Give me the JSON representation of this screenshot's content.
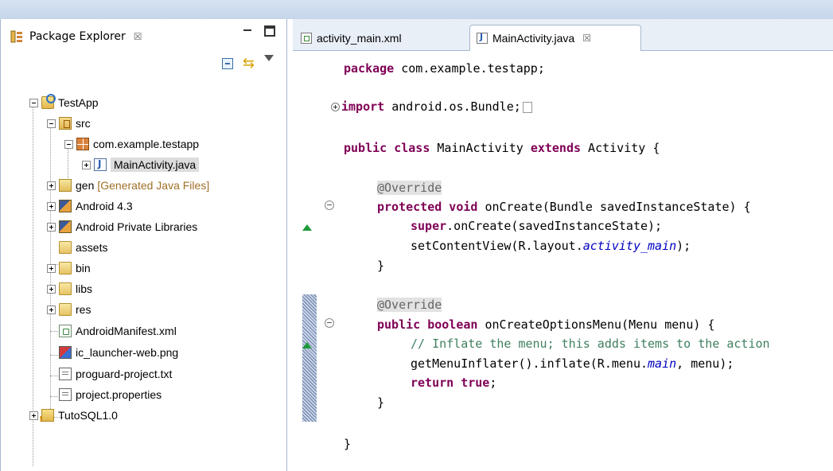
{
  "package_explorer": {
    "title": "Package Explorer",
    "close_glyph": "☒",
    "tree": [
      {
        "label": "TestApp",
        "icon": "android-project-icon"
      },
      {
        "label": "src",
        "icon": "source-folder-icon"
      },
      {
        "label": "com.example.testapp",
        "icon": "package-icon"
      },
      {
        "label": "MainActivity.java",
        "icon": "java-file-icon",
        "selected": true
      },
      {
        "label": "gen",
        "decoration": "[Generated Java Files]",
        "icon": "generated-folder-icon"
      },
      {
        "label": "Android 4.3",
        "icon": "library-icon"
      },
      {
        "label": "Android Private Libraries",
        "icon": "library-icon"
      },
      {
        "label": "assets",
        "icon": "folder-icon"
      },
      {
        "label": "bin",
        "icon": "folder-icon"
      },
      {
        "label": "libs",
        "icon": "folder-icon"
      },
      {
        "label": "res",
        "icon": "folder-icon"
      },
      {
        "label": "AndroidManifest.xml",
        "icon": "xml-file-icon"
      },
      {
        "label": "ic_launcher-web.png",
        "icon": "image-file-icon"
      },
      {
        "label": "proguard-project.txt",
        "icon": "text-file-icon"
      },
      {
        "label": "project.properties",
        "icon": "text-file-icon"
      },
      {
        "label": "TutoSQL1.0",
        "icon": "android-project-icon"
      }
    ]
  },
  "editor": {
    "tabs": [
      {
        "label": "activity_main.xml",
        "active": false
      },
      {
        "label": "MainActivity.java",
        "active": true,
        "close_glyph": "☒"
      }
    ],
    "code": {
      "l1_kw": "package",
      "l1_rest": " com.example.testapp;",
      "l2_kw": "import",
      "l2_rest": " android.os.Bundle;",
      "l3_kw": "public class",
      "l3_mid": " MainActivity ",
      "l3_kw2": "extends",
      "l3_rest": " Activity {",
      "l4_ann": "@Override",
      "l5_kw": "protected void",
      "l5_rest": " onCreate(Bundle savedInstanceState) {",
      "l6_kw": "super",
      "l6_rest": ".onCreate(savedInstanceState);",
      "l7_pre": "setContentView(R.layout.",
      "l7_fld": "activity_main",
      "l7_post": ");",
      "l8": "}",
      "l9_ann": "@Override",
      "l10_kw": "public boolean",
      "l10_rest": " onCreateOptionsMenu(Menu menu) {",
      "l11_cmt": "// Inflate the menu; this adds items to the action",
      "l12_pre": "getMenuInflater().inflate(R.menu.",
      "l12_fld": "main",
      "l12_post": ", menu);",
      "l13_kw": "return true",
      "l13_rest": ";",
      "l14": "}",
      "l15": "}"
    }
  }
}
